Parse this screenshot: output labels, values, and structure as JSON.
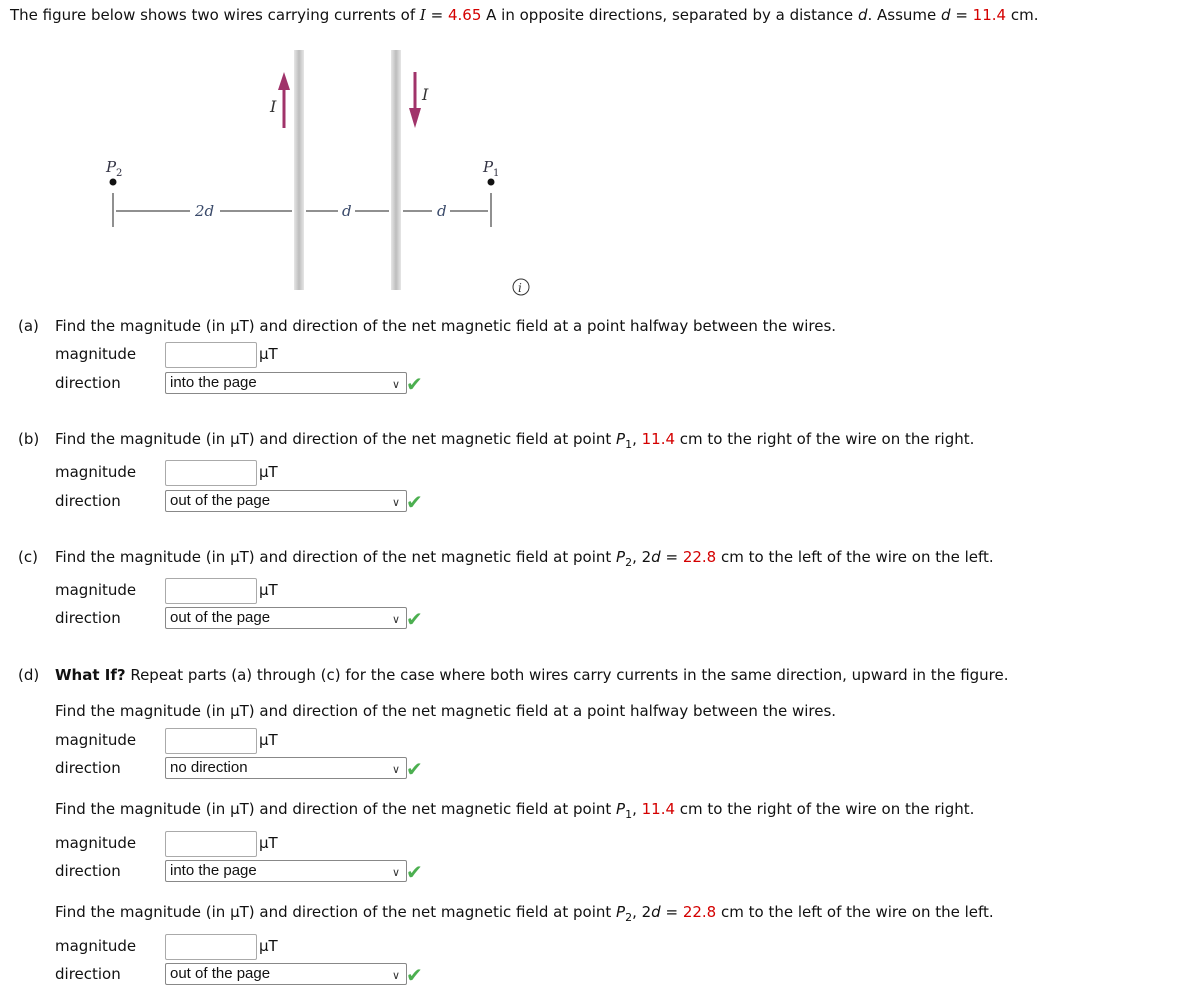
{
  "intro": {
    "t1": "The figure below shows two wires carrying currents of ",
    "I_sym": "I",
    "eq": " = ",
    "current_value": "4.65",
    "t2": " A in opposite directions, separated by a distance ",
    "d_sym": "d",
    "t3": ". Assume ",
    "d_sym2": "d",
    "eq2": " = ",
    "d_value": "11.4",
    "t4": " cm."
  },
  "figure": {
    "current_label_left": "I",
    "current_label_right": "I",
    "p2_label": "P",
    "p2_sub": "2",
    "p1_label": "P",
    "p1_sub": "1",
    "dim_2d": "2d",
    "dim_d1": "d",
    "dim_d2": "d",
    "info_icon": "i",
    "arrow_color": "#a0336a"
  },
  "labels": {
    "magnitude": "magnitude",
    "direction": "direction",
    "unit": "μT",
    "check": "✔",
    "chevron": "∨"
  },
  "parts": {
    "a": {
      "letter": "(a)",
      "text": "Find the magnitude (in μT) and direction of the net magnetic field at a point halfway between the wires.",
      "magnitude_value": "",
      "direction_value": "into the page"
    },
    "b": {
      "letter": "(b)",
      "text1": "Find the magnitude (in μT) and direction of the net magnetic field at point ",
      "P": "P",
      "sub": "1",
      "comma": ", ",
      "value": "11.4",
      "text2": " cm to the right of the wire on the right.",
      "magnitude_value": "",
      "direction_value": "out of the page"
    },
    "c": {
      "letter": "(c)",
      "text1": "Find the magnitude (in μT) and direction of the net magnetic field at point ",
      "P": "P",
      "sub": "2",
      "comma": ", 2",
      "d": "d",
      "eq": " = ",
      "value": "22.8",
      "text2": " cm to the left of the wire on the left.",
      "magnitude_value": "",
      "direction_value": "out of the page"
    },
    "d": {
      "letter": "(d)",
      "bold": "What If?",
      "intro": " Repeat parts (a) through (c) for the case where both wires carry currents in the same direction, upward in the figure.",
      "sub1": {
        "text": "Find the magnitude (in μT) and direction of the net magnetic field at a point halfway between the wires.",
        "magnitude_value": "",
        "direction_value": "no direction"
      },
      "sub2": {
        "text1": "Find the magnitude (in μT) and direction of the net magnetic field at point ",
        "P": "P",
        "sub": "1",
        "comma": ", ",
        "value": "11.4",
        "text2": " cm to the right of the wire on the right.",
        "magnitude_value": "",
        "direction_value": "into the page"
      },
      "sub3": {
        "text1": "Find the magnitude (in μT) and direction of the net magnetic field at point ",
        "P": "P",
        "sub": "2",
        "comma": ", 2",
        "d": "d",
        "eq": " = ",
        "value": "22.8",
        "text2": " cm to the left of the wire on the left.",
        "magnitude_value": "",
        "direction_value": "out of the page"
      }
    }
  }
}
